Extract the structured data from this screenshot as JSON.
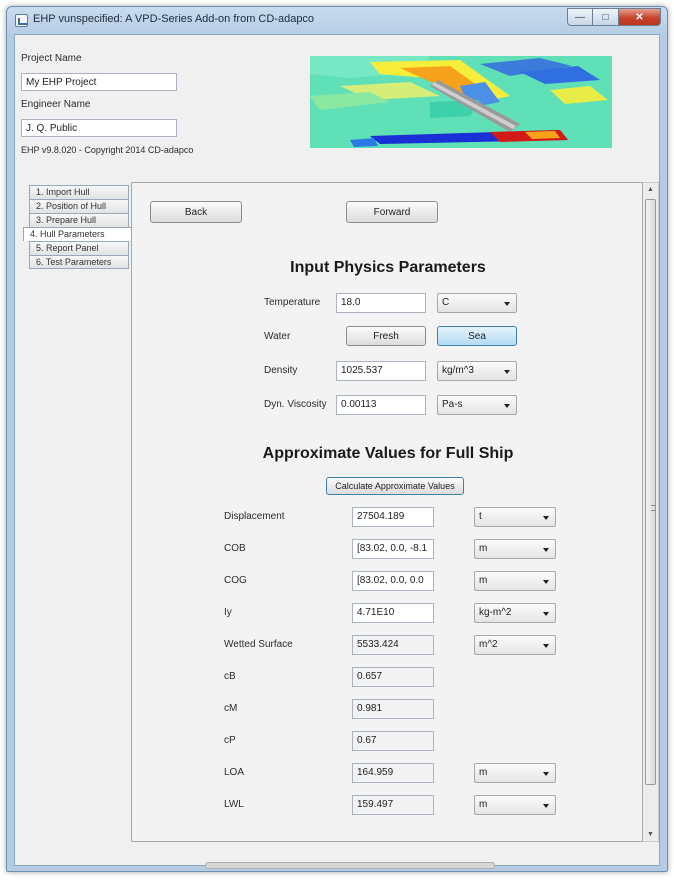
{
  "window": {
    "title": "EHP vunspecified: A VPD-Series Add-on from CD-adapco",
    "controls": {
      "minimize": "—",
      "maximize": "□",
      "close": "✕"
    }
  },
  "project": {
    "name_label": "Project Name",
    "name_value": "My EHP Project",
    "engineer_label": "Engineer Name",
    "engineer_value": "J. Q. Public",
    "copyright": "EHP v9.8.020 - Copyright 2014 CD-adapco"
  },
  "tabs": [
    {
      "label": "1. Import Hull"
    },
    {
      "label": "2. Position of Hull"
    },
    {
      "label": "3. Prepare Hull"
    },
    {
      "label": "4. Hull Parameters"
    },
    {
      "label": "5. Report Panel"
    },
    {
      "label": "6. Test Parameters"
    }
  ],
  "nav": {
    "back": "Back",
    "forward": "Forward"
  },
  "physics": {
    "title": "Input Physics Parameters",
    "temperature_label": "Temperature",
    "temperature_value": "18.0",
    "temperature_unit": "C",
    "water_label": "Water",
    "water_fresh": "Fresh",
    "water_sea": "Sea",
    "water_selected": "Sea",
    "density_label": "Density",
    "density_value": "1025.537",
    "density_unit": "kg/m^3",
    "viscosity_label": "Dyn. Viscosity",
    "viscosity_value": "0.00113",
    "viscosity_unit": "Pa-s"
  },
  "approx": {
    "title": "Approximate Values for Full Ship",
    "calculate": "Calculate Approximate Values",
    "rows": [
      {
        "label": "Displacement",
        "value": "27504.189",
        "unit": "t",
        "readonly": false
      },
      {
        "label": "COB",
        "value": "[83.02, 0.0, -8.1",
        "unit": "m",
        "readonly": false
      },
      {
        "label": "COG",
        "value": "[83.02, 0.0, 0.0",
        "unit": "m",
        "readonly": false
      },
      {
        "label": "Iy",
        "value": "4.71E10",
        "unit": "kg-m^2",
        "readonly": false
      },
      {
        "label": "Wetted Surface",
        "value": "5533.424",
        "unit": "m^2",
        "readonly": true
      },
      {
        "label": "cB",
        "value": "0.657",
        "unit": "",
        "readonly": true
      },
      {
        "label": "cM",
        "value": "0.981",
        "unit": "",
        "readonly": true
      },
      {
        "label": "cP",
        "value": "0.67",
        "unit": "",
        "readonly": true
      },
      {
        "label": "LOA",
        "value": "164.959",
        "unit": "m",
        "readonly": true
      },
      {
        "label": "LWL",
        "value": "159.497",
        "unit": "m",
        "readonly": true
      }
    ]
  },
  "colors": {
    "preview_background": "#5fe0b6",
    "selected_button": "#b3dbf4",
    "titlebar": "#b4cbe3"
  },
  "icons": {
    "app": "app-icon",
    "scroll_up": "scroll-up-icon",
    "scroll_down": "scroll-down-icon"
  }
}
